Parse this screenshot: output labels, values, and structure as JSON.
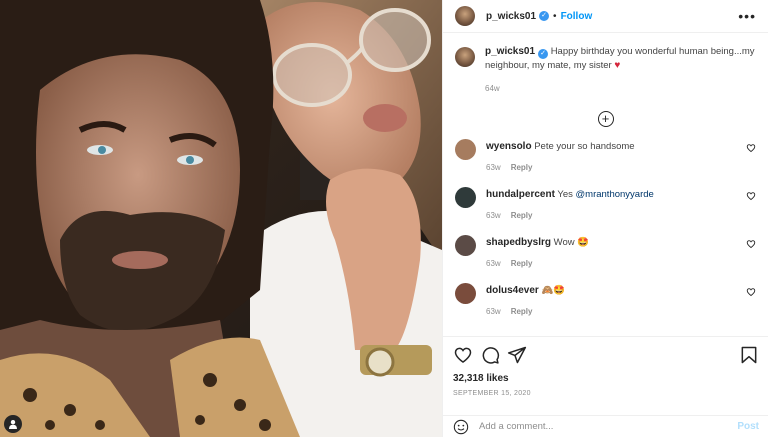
{
  "post": {
    "author": "p_wicks01",
    "follow_label": "Follow",
    "separator": "•",
    "more_label": "•••",
    "caption": "Happy birthday you wonderful human being...my neighbour, my mate, my sister",
    "caption_time": "64w",
    "likes": "32,318 likes",
    "date": "SEPTEMBER 15, 2020"
  },
  "comments": [
    {
      "user": "wyensolo",
      "text": "Pete your so handsome",
      "mention": "",
      "time": "63w",
      "reply": "Reply",
      "avatar_color": "#a67c5f"
    },
    {
      "user": "hundalpercent",
      "text": "Yes ",
      "mention": "@mranthonyyarde",
      "time": "63w",
      "reply": "Reply",
      "avatar_color": "#2f3a3a"
    },
    {
      "user": "shapedbyslrg",
      "text": "Wow 🤩",
      "mention": "",
      "time": "63w",
      "reply": "Reply",
      "avatar_color": "#5b4b46"
    },
    {
      "user": "dolus4ever",
      "text": "🙈🤩",
      "mention": "",
      "time": "63w",
      "reply": "Reply",
      "avatar_color": "#7a4c3c"
    }
  ],
  "add_comment": {
    "placeholder": "Add a comment...",
    "post_label": "Post"
  },
  "icons": {
    "verified": "verified-badge-icon",
    "load_more": "plus-circle-icon",
    "like": "heart-icon",
    "comment": "comment-icon",
    "share": "share-icon",
    "save": "bookmark-icon",
    "emoji": "emoji-icon",
    "tag": "user-tag-icon"
  },
  "colors": {
    "link": "#0095f6",
    "verified": "#3897f0",
    "heart": "#d4253b",
    "post_disabled": "#b2dffc"
  }
}
